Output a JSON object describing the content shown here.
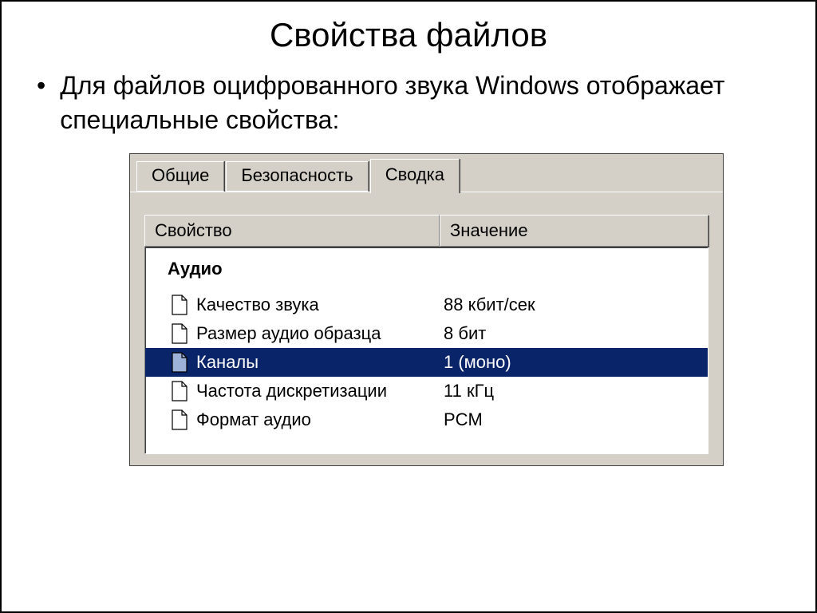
{
  "slide": {
    "title": "Свойства файлов",
    "bullet": "Для файлов оцифрованного звука Windows отображает специальные свойства:"
  },
  "dialog": {
    "tabs": {
      "general": "Общие",
      "security": "Безопасность",
      "summary": "Сводка"
    },
    "columns": {
      "property": "Свойство",
      "value": "Значение"
    },
    "group": "Аудио",
    "rows": [
      {
        "prop": "Качество звука",
        "val": "88 кбит/сек",
        "selected": false
      },
      {
        "prop": "Размер аудио образца",
        "val": "8 бит",
        "selected": false
      },
      {
        "prop": "Каналы",
        "val": "1 (моно)",
        "selected": true
      },
      {
        "prop": "Частота дискретизации",
        "val": "11 кГц",
        "selected": false
      },
      {
        "prop": "Формат аудио",
        "val": "PCM",
        "selected": false
      }
    ]
  }
}
